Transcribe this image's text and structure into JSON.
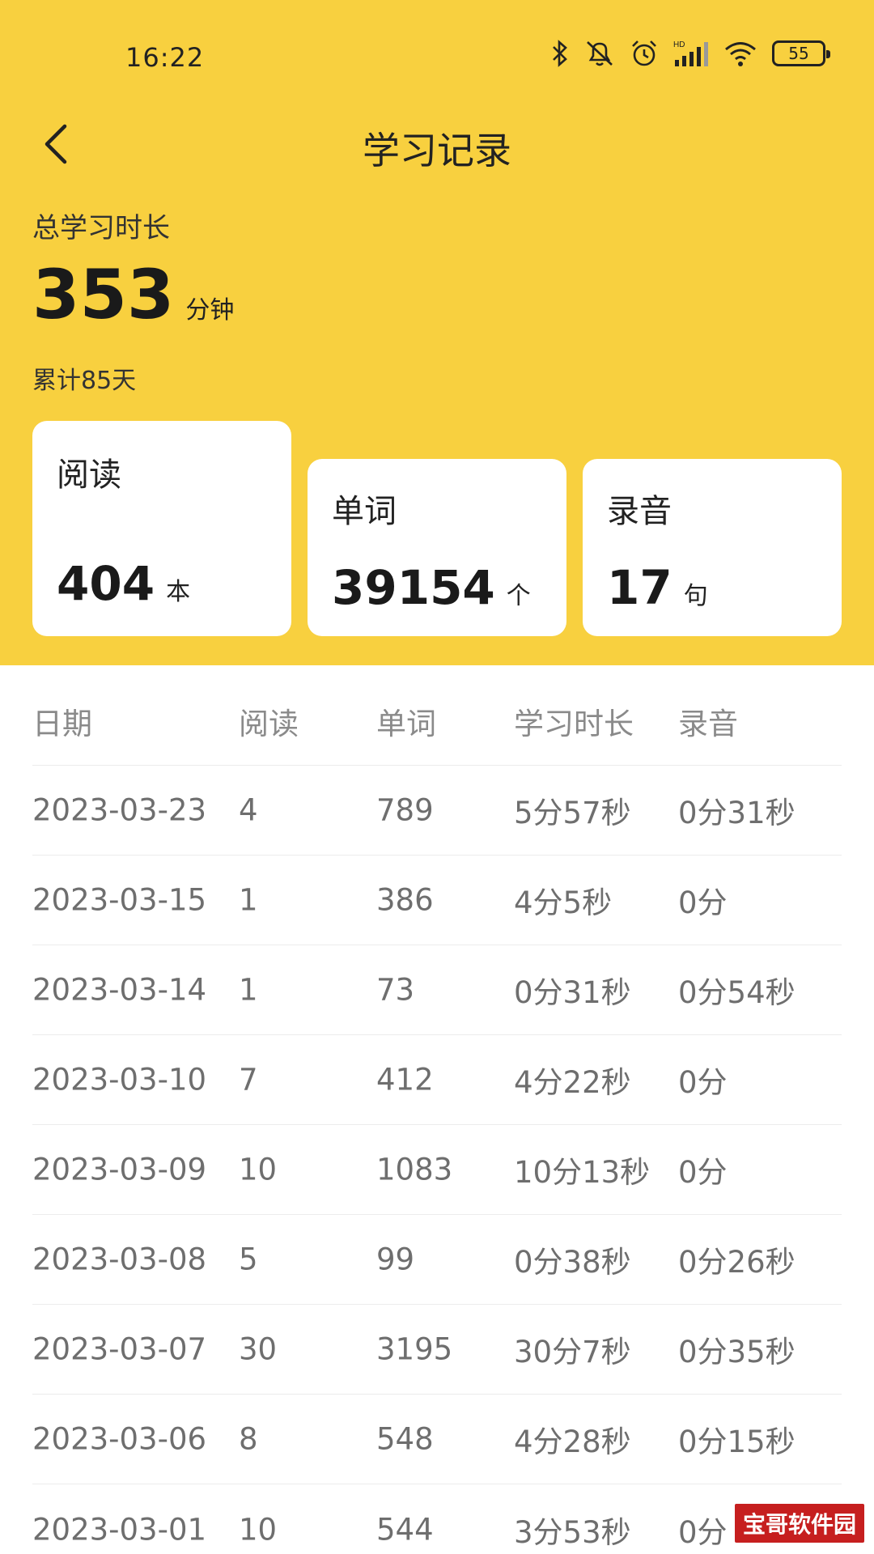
{
  "status_bar": {
    "time": "16:22",
    "battery": "55"
  },
  "header": {
    "title": "学习记录"
  },
  "summary": {
    "total_label": "总学习时长",
    "total_value": "353",
    "total_unit": "分钟",
    "cumulative": "累计85天"
  },
  "cards": [
    {
      "label": "阅读",
      "value": "404",
      "unit": "本"
    },
    {
      "label": "单词",
      "value": "39154",
      "unit": "个"
    },
    {
      "label": "录音",
      "value": "17",
      "unit": "句"
    }
  ],
  "table": {
    "headers": [
      "日期",
      "阅读",
      "单词",
      "学习时长",
      "录音"
    ],
    "rows": [
      [
        "2023-03-23",
        "4",
        "789",
        "5分57秒",
        "0分31秒"
      ],
      [
        "2023-03-15",
        "1",
        "386",
        "4分5秒",
        "0分"
      ],
      [
        "2023-03-14",
        "1",
        "73",
        "0分31秒",
        "0分54秒"
      ],
      [
        "2023-03-10",
        "7",
        "412",
        "4分22秒",
        "0分"
      ],
      [
        "2023-03-09",
        "10",
        "1083",
        "10分13秒",
        "0分"
      ],
      [
        "2023-03-08",
        "5",
        "99",
        "0分38秒",
        "0分26秒"
      ],
      [
        "2023-03-07",
        "30",
        "3195",
        "30分7秒",
        "0分35秒"
      ],
      [
        "2023-03-06",
        "8",
        "548",
        "4分28秒",
        "0分15秒"
      ],
      [
        "2023-03-01",
        "10",
        "544",
        "3分53秒",
        "0分"
      ]
    ]
  },
  "watermark": "宝哥软件园",
  "colors": {
    "header_bg": "#F8D03F",
    "card_bg": "#FFFFFF",
    "text_muted": "#6E6E6E"
  }
}
